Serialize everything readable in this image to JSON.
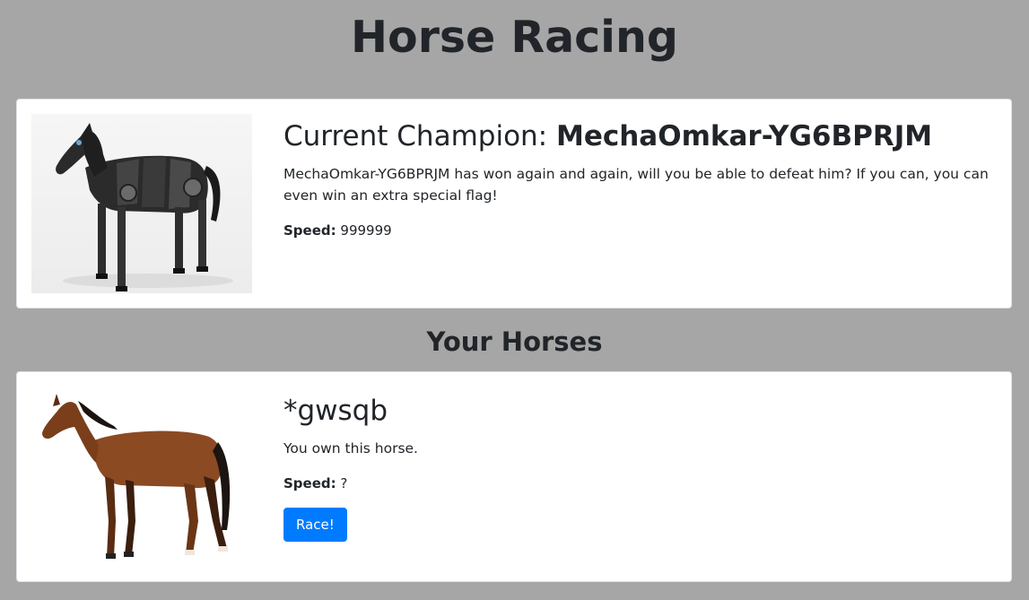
{
  "page": {
    "title": "Horse Racing"
  },
  "champion": {
    "title_prefix": "Current Champion: ",
    "name": "MechaOmkar-YG6BPRJM",
    "description": "MechaOmkar-YG6BPRJM has won again and again, will you be able to defeat him? If you can, you can even win an extra special flag!",
    "speed_label": "Speed:",
    "speed_value": "999999",
    "image_icon": "robot-horse-image"
  },
  "your_horses": {
    "heading": "Your Horses",
    "items": [
      {
        "name": "*gwsqb",
        "description": "You own this horse.",
        "speed_label": "Speed:",
        "speed_value": "?",
        "button_label": "Race!",
        "image_icon": "bay-horse-image"
      }
    ]
  },
  "colors": {
    "background": "#a6a6a6",
    "button": "#007bff"
  }
}
